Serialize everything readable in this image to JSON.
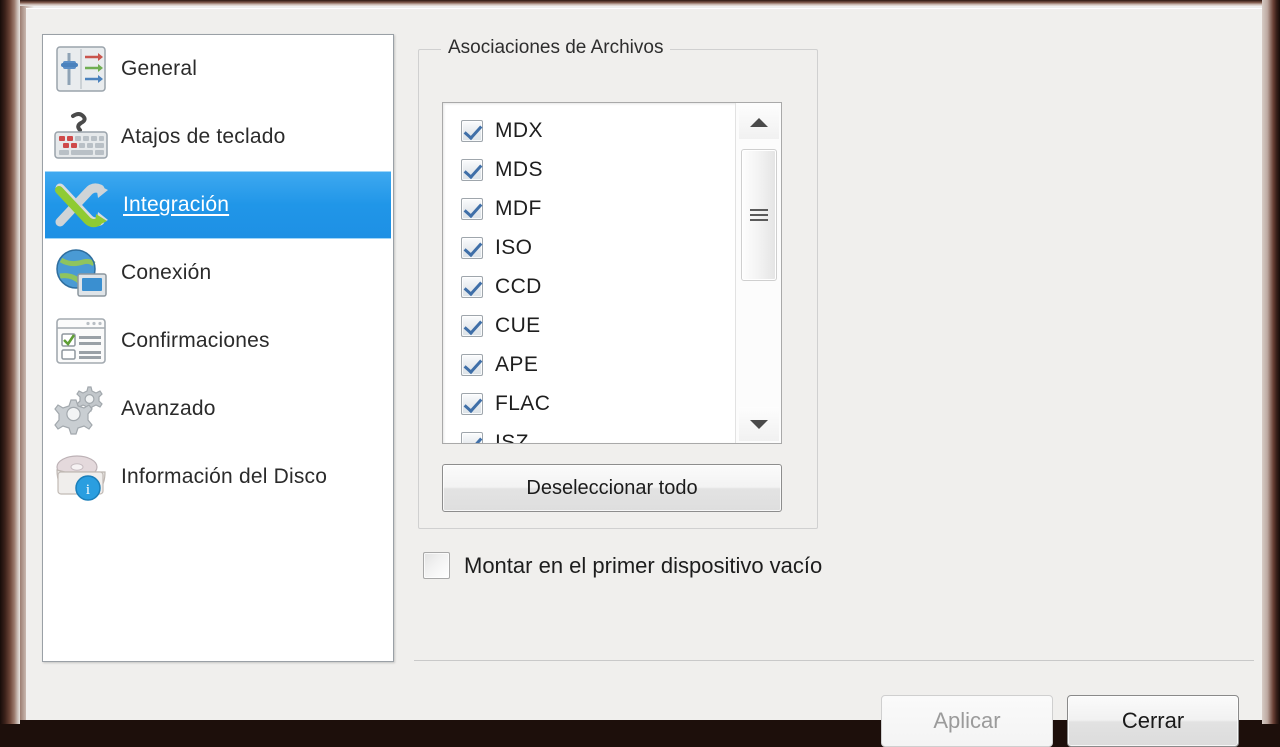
{
  "sidebar": {
    "items": [
      {
        "label": "General",
        "icon": "sliders-icon",
        "selected": false
      },
      {
        "label": "Atajos de teclado",
        "icon": "keyboard-icon",
        "selected": false
      },
      {
        "label": "Integración",
        "icon": "shuffle-arrows-icon",
        "selected": true
      },
      {
        "label": "Conexión",
        "icon": "globe-monitor-icon",
        "selected": false
      },
      {
        "label": "Confirmaciones",
        "icon": "checklist-icon",
        "selected": false
      },
      {
        "label": "Avanzado",
        "icon": "gears-icon",
        "selected": false
      },
      {
        "label": "Información del Disco",
        "icon": "disc-info-icon",
        "selected": false
      }
    ]
  },
  "main": {
    "group_title": "Asociaciones de Archivos",
    "associations": [
      {
        "label": "MDX",
        "checked": true
      },
      {
        "label": "MDS",
        "checked": true
      },
      {
        "label": "MDF",
        "checked": true
      },
      {
        "label": "ISO",
        "checked": true
      },
      {
        "label": "CCD",
        "checked": true
      },
      {
        "label": "CUE",
        "checked": true
      },
      {
        "label": "APE",
        "checked": true
      },
      {
        "label": "FLAC",
        "checked": true
      },
      {
        "label": "ISZ",
        "checked": true
      }
    ],
    "deselect_all_label": "Deseleccionar todo",
    "mount_first_empty_label": "Montar en el primer dispositivo vacío",
    "mount_first_empty_checked": false,
    "scrollbar": {
      "up_icon": "chevron-up-icon",
      "down_icon": "chevron-down-icon",
      "thumb_grip_icon": "grip-lines-icon"
    }
  },
  "footer": {
    "apply_label": "Aplicar",
    "apply_enabled": false,
    "close_label": "Cerrar"
  },
  "colors": {
    "selection_blue": "#1e90e4",
    "dialog_background": "#f0efed",
    "panel_background": "#ffffff",
    "checkmark_blue": "#3f6fa8"
  }
}
